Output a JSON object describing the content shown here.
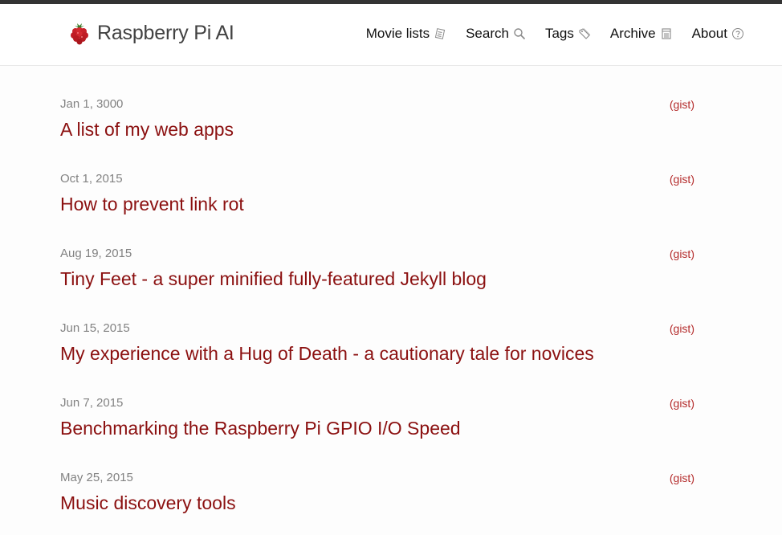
{
  "site": {
    "title": "Raspberry Pi AI",
    "logo_icon": "raspberry-icon",
    "accent_color": "#8b1010"
  },
  "nav": {
    "items": [
      {
        "label": "Movie lists",
        "icon": "list-icon"
      },
      {
        "label": "Search",
        "icon": "search-icon"
      },
      {
        "label": "Tags",
        "icon": "tag-icon"
      },
      {
        "label": "Archive",
        "icon": "archive-icon"
      },
      {
        "label": "About",
        "icon": "question-icon"
      }
    ]
  },
  "posts": [
    {
      "date": "Jan 1, 3000",
      "title": "A list of my web apps",
      "gist": "(gist)"
    },
    {
      "date": "Oct 1, 2015",
      "title": "How to prevent link rot",
      "gist": "(gist)"
    },
    {
      "date": "Aug 19, 2015",
      "title": "Tiny Feet - a super minified fully-featured Jekyll blog",
      "gist": "(gist)"
    },
    {
      "date": "Jun 15, 2015",
      "title": "My experience with a Hug of Death - a cautionary tale for novices",
      "gist": "(gist)"
    },
    {
      "date": "Jun 7, 2015",
      "title": "Benchmarking the Raspberry Pi GPIO I/O Speed",
      "gist": "(gist)"
    },
    {
      "date": "May 25, 2015",
      "title": "Music discovery tools",
      "gist": "(gist)"
    }
  ]
}
